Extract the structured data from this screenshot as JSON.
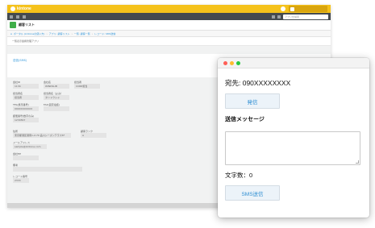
{
  "kintone": {
    "logo_text": "kintone",
    "search_placeholder": "アプリを検索",
    "app_title": "顧客リスト",
    "breadcrumbs": [
      "ポータル (kintoneの使い方)",
      "アプリ: 顧客リスト",
      "一覧: 顧客一覧",
      "レコード: SMS送信"
    ],
    "record_title": "一覧表示連携管理アプリ",
    "tab_button": "送信(SMS)",
    "fields": [
      {
        "label": "会社ID",
        "value": "1134"
      },
      {
        "label": "会社名",
        "value": "WINDSLIB"
      },
      {
        "label": "担当者",
        "value": "CORP担当"
      },
      {
        "label": "担当者名",
        "value": "担当者"
      },
      {
        "label": "担当者名（よみ）",
        "value": "タントウシャ"
      },
      {
        "label": "TEL(携帯番号)",
        "value": "090XXXXXXXX"
      },
      {
        "label": "FAX(固定電話)",
        "value": ""
      },
      {
        "label": "郵便番号(数字のみ)",
        "value": "1234567"
      },
      {
        "label": "住所",
        "value": "東京都港区港南1-2-70 品川シーズンテラス5F"
      },
      {
        "label": "顧客ランク",
        "value": "A"
      },
      {
        "label": "メールアドレス",
        "value": "sample@kintone.com"
      },
      {
        "label": "会社HP",
        "value": ""
      },
      {
        "label": "備考",
        "value": ""
      },
      {
        "label": "レコード番号",
        "value": "2333"
      }
    ]
  },
  "popup": {
    "to_label": "宛先: 090XXXXXXXX",
    "send_button": "発信",
    "message_label": "送信メッセージ",
    "message_value": "",
    "char_count": "文字数：0",
    "sms_button": "SMS送信",
    "dot_colors": [
      "#ff5f57",
      "#febc2e",
      "#28c840"
    ]
  }
}
